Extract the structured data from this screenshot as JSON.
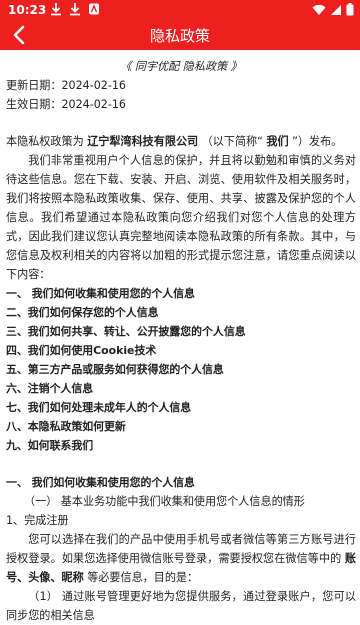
{
  "status": {
    "time": "10:23"
  },
  "appbar": {
    "title": "隐私政策"
  },
  "doc": {
    "title": "《 同宇优配 隐私政策 》",
    "updated": "更新日期：2024-02-16",
    "effective": "生效日期：2024-02-16",
    "intro_pre": "本隐私权政策为 ",
    "company": "辽宁犁湾科技有限公司",
    "intro_mid": " （以下简称“ ",
    "we": "我们",
    "intro_post": " ”）发布。",
    "p1": "我们非常重视用户个人信息的保护，并且将以勤勉和审慎的义务对待这些信息。您在下载、安装、开启、浏览、使用软件及相关服务时，我们将按照本隐私政策收集、保存、使用、共享、披露及保护您的个人信息。我们希望通过本隐私政策向您介绍我们对您个人信息的处理方式，因此我们建议您认真完整地阅读本隐私政策的所有条款。其中，与您信息及权利相关的内容将以加粗的形式提示您注意，请您重点阅读以下内容：",
    "toc": [
      "一、 我们如何收集和使用您的个人信息",
      "二、我们如何保存您的个人信息",
      "三、我们如何共享、转让、公开披露您的个人信息",
      "四、我们如何使用Cookie技术",
      "五、第三方产品或服务如何获得您的个人信息",
      "六、注销个人信息",
      "七、我们如何处理未成年人的个人信息",
      "八、本隐私政策如何更新",
      "九、如何联系我们"
    ],
    "sec1": "一、 我们如何收集和使用您的个人信息",
    "sub1": "（一） 基本业务功能中我们收集和使用您个人信息的情形",
    "item1": "1、完成注册",
    "p2_a": "您可以选择在我们的产品中使用手机号或者微信等第三方账号进行授权登录。如果您选择使用微信账号登录，需要授权您在微信等中的 ",
    "p2_bold": "账号、头像、昵称",
    "p2_b": " 等必要信息，目的是：",
    "p3": "（1） 通过账号管理更好地为您提供服务，通过登录账户，您可以同步您的相关信息"
  }
}
